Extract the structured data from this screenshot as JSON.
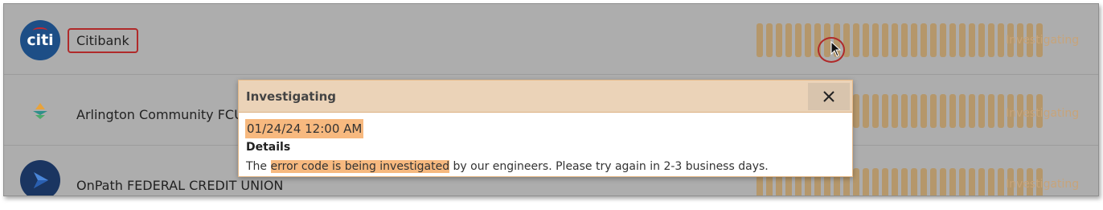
{
  "banks": [
    {
      "name": "Citibank",
      "logo_text": "citi",
      "status": "Investigating"
    },
    {
      "name": "Arlington Community FCU",
      "status": "Investigating"
    },
    {
      "name": "OnPath FEDERAL CREDIT UNION",
      "status": "Investigating"
    }
  ],
  "status_bars": {
    "count": 30,
    "color": "#b5976b"
  },
  "popup": {
    "title": "Investigating",
    "date": "01/24/24 12:00 AM",
    "details_label": "Details",
    "message_prefix": "The ",
    "message_highlight": "error code is being investigated",
    "message_suffix": " by our engineers. Please try again in 2-3 business days.",
    "close_icon": "close-icon"
  },
  "colors": {
    "overlay": "#adadad",
    "highlight": "#f7b97f",
    "status_text": "#c7a47a",
    "popup_header": "#ebd3b8"
  }
}
